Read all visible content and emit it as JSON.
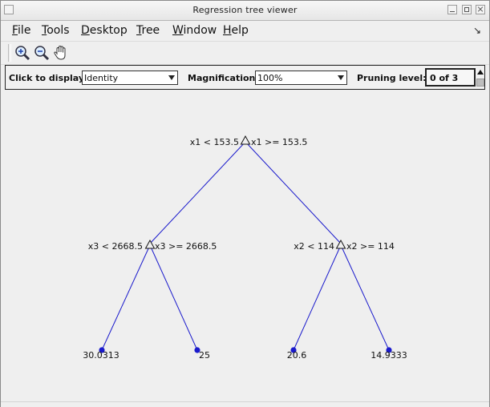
{
  "window": {
    "title": "Regression tree viewer"
  },
  "menubar": {
    "items": [
      {
        "label": "File",
        "mnemonic": "F",
        "rest": "ile"
      },
      {
        "label": "Tools",
        "mnemonic": "T",
        "rest": "ools"
      },
      {
        "label": "Desktop",
        "mnemonic": "D",
        "rest": "esktop"
      },
      {
        "label": "Tree",
        "mnemonic": "T",
        "rest": "ree"
      },
      {
        "label": "Window",
        "mnemonic": "W",
        "rest": "indow"
      },
      {
        "label": "Help",
        "mnemonic": "H",
        "rest": "elp"
      }
    ],
    "dock_icon": "↘"
  },
  "toolbar": {
    "tools": [
      {
        "icon": "zoom-in-icon"
      },
      {
        "icon": "zoom-out-icon"
      },
      {
        "icon": "pan-hand-icon"
      }
    ]
  },
  "controls": {
    "click_to_display_label": "Click to display:",
    "click_to_display_value": "Identity",
    "magnification_label": "Magnification:",
    "magnification_value": "100%",
    "pruning_label": "Pruning level:",
    "pruning_value": "0 of 3"
  },
  "tree": {
    "root": {
      "left_rule": "x1 < 153.5",
      "right_rule": "x1 >= 153.5"
    },
    "left_branch": {
      "left_rule": "x3 < 2668.5",
      "right_rule": "x3 >= 2668.5"
    },
    "right_branch": {
      "left_rule": "x2 < 114",
      "right_rule": "x2 >= 114"
    },
    "leaves": [
      "30.0313",
      "25",
      "20.6",
      "14.9333"
    ],
    "colors": {
      "edge": "#1a1acc",
      "leaf": "#1a1acc",
      "node_stroke": "#111111"
    }
  }
}
